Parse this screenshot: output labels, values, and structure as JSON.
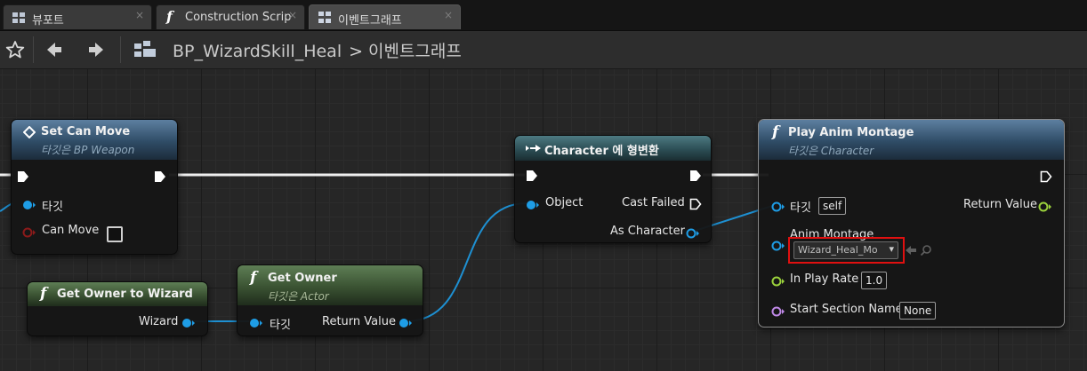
{
  "tabs": [
    {
      "label": "뷰포트",
      "close": "×",
      "icon": "viewport-grid-icon"
    },
    {
      "label": "Construction Scrip",
      "close": "×",
      "icon": "function-icon"
    },
    {
      "label": "이벤트그래프",
      "close": "×",
      "icon": "event-graph-icon"
    }
  ],
  "breadcrumb": {
    "blueprint": "BP_WizardSkill_Heal",
    "separator": ">",
    "graph": "이벤트그래프"
  },
  "nodes": {
    "set_can_move": {
      "title": "Set Can Move",
      "subtitle": "타깃은 BP Weapon",
      "target_label": "타깃",
      "can_move_label": "Can Move"
    },
    "get_owner_to_wizard": {
      "title": "Get Owner to Wizard",
      "wizard_label": "Wizard"
    },
    "get_owner": {
      "title": "Get Owner",
      "subtitle": "타깃은 Actor",
      "target_label": "타깃",
      "return_label": "Return Value"
    },
    "cast": {
      "title": "Character 에 형변환",
      "object_label": "Object",
      "cast_failed_label": "Cast Failed",
      "as_character_label": "As Character"
    },
    "play_anim": {
      "title": "Play Anim Montage",
      "subtitle": "타깃은 Character",
      "target_label": "타깃",
      "target_value": "self",
      "return_label": "Return Value",
      "montage_label": "Anim Montage",
      "montage_value": "Wizard_Heal_Mo",
      "play_rate_label": "In Play Rate",
      "play_rate_value": "1.0",
      "start_section_label": "Start Section Name",
      "start_section_value": "None"
    }
  },
  "colors": {
    "object_pin": "#1e9de6",
    "float_pin": "#9bd23c",
    "name_pin": "#c089e8",
    "bool_pin": "#8c1a1a",
    "exec": "#ffffff",
    "highlight": "#e01010"
  }
}
